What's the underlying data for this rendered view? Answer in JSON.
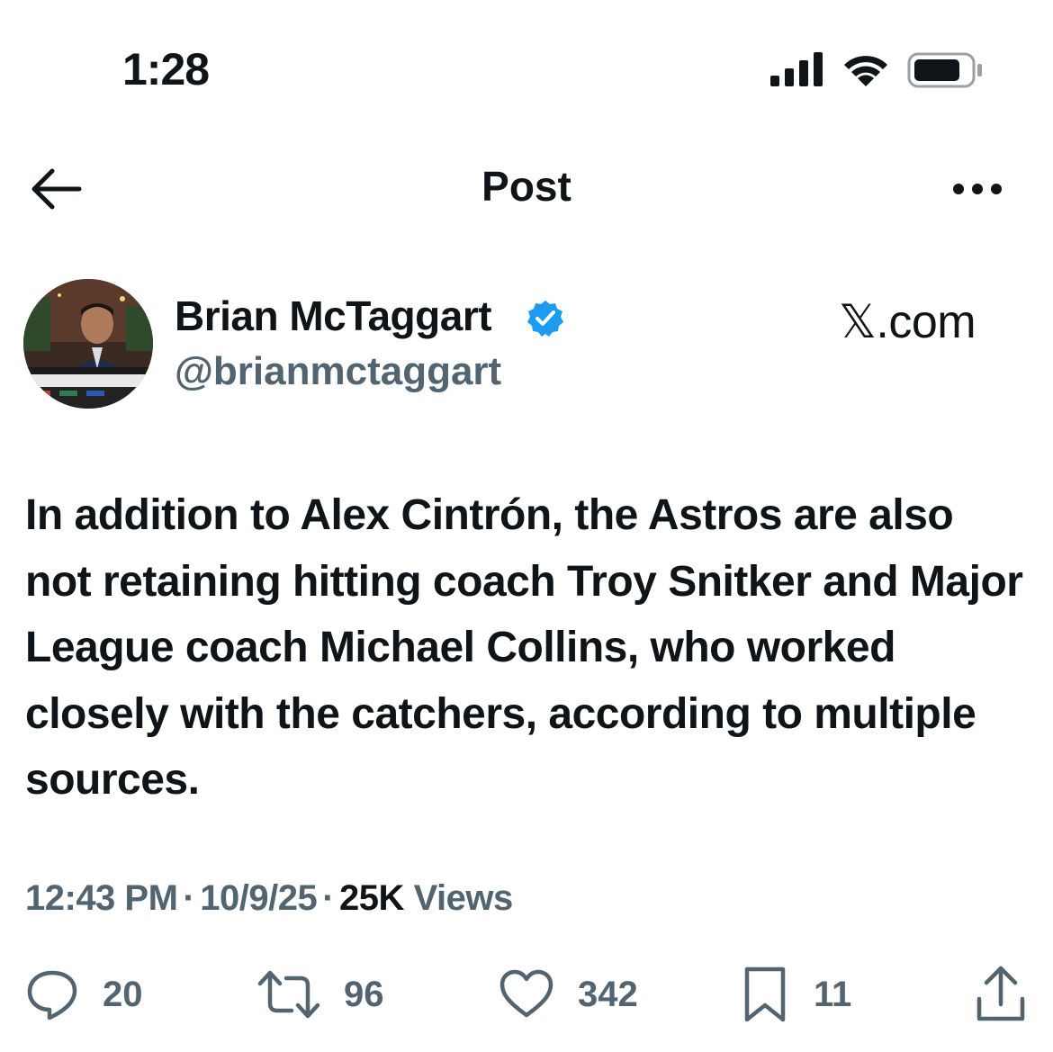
{
  "status_bar": {
    "time": "1:28"
  },
  "nav": {
    "title": "Post"
  },
  "author": {
    "name": "Brian McTaggart",
    "handle": "@brianmctaggart",
    "verified": true
  },
  "source": "𝕏.com",
  "post": {
    "text": "In addition to Alex Cintrón, the Astros are also not retaining hitting coach Troy Snitker and Major League coach Michael Collins, who worked closely with the catchers, according to multiple sources."
  },
  "meta": {
    "time": "12:43 PM",
    "date": "10/9/25",
    "views_count": "25K",
    "views_label": "Views",
    "separator": "·"
  },
  "actions": {
    "replies": "20",
    "reposts": "96",
    "likes": "342",
    "bookmarks": "11"
  },
  "colors": {
    "text": "#0f1419",
    "secondary": "#536471",
    "verified": "#1d9bf0"
  },
  "icons": [
    "back-arrow-icon",
    "more-icon",
    "verified-icon",
    "reply-icon",
    "repost-icon",
    "like-icon",
    "bookmark-icon",
    "share-icon"
  ]
}
